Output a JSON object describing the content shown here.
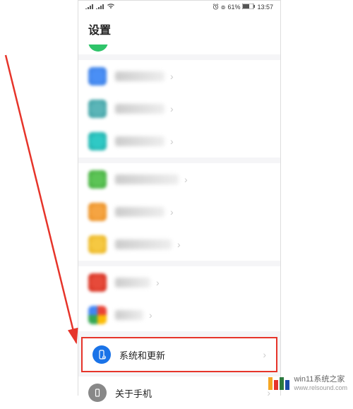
{
  "status": {
    "battery_pct": "61%",
    "time": "13:57"
  },
  "header": {
    "title": "设置"
  },
  "groups": [
    {
      "items": [
        {
          "icon": "blue1"
        },
        {
          "icon": "blue2"
        },
        {
          "icon": "teal"
        }
      ]
    },
    {
      "items": [
        {
          "icon": "green"
        },
        {
          "icon": "orange"
        },
        {
          "icon": "yellow"
        }
      ]
    },
    {
      "items": [
        {
          "icon": "red"
        },
        {
          "icon": "multi"
        }
      ]
    }
  ],
  "highlighted": {
    "icon": "sysblue",
    "label": "系统和更新"
  },
  "last": {
    "icon": "grey",
    "label": "关于手机"
  },
  "watermark": {
    "brand": "win11系统之家",
    "url": "www.relsound.com"
  }
}
